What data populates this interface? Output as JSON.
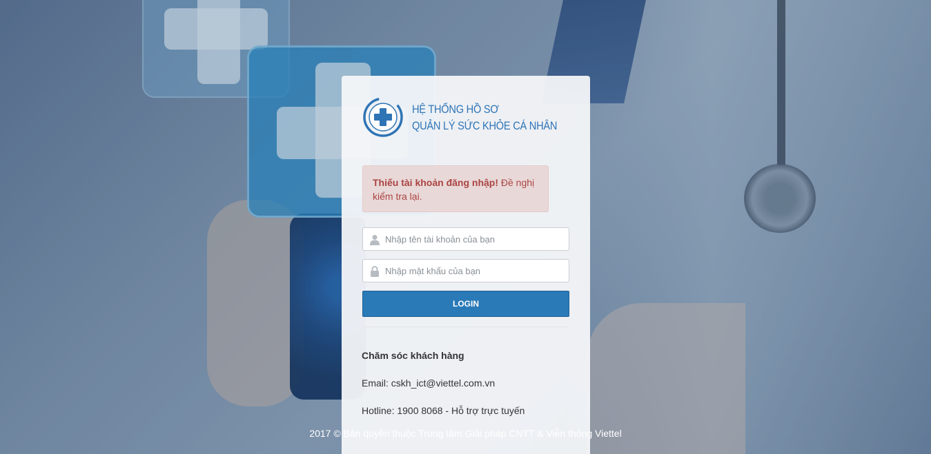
{
  "brand": {
    "line1": "HỆ THỐNG HỒ SƠ",
    "line2": "QUẢN LÝ SỨC KHỎE CÁ NHÂN",
    "color": "#2f74b5"
  },
  "alert": {
    "strong": "Thiếu tài khoản đăng nhập!",
    "message": " Đề nghị kiểm tra lại."
  },
  "form": {
    "username_placeholder": "Nhập tên tài khoản của bạn",
    "password_placeholder": "Nhập mật khẩu của bạn",
    "login_label": "LOGIN"
  },
  "support": {
    "title": "Chăm sóc khách hàng",
    "email": "Email: cskh_ict@viettel.com.vn",
    "hotline": "Hotline: 1900 8068 - Hỗ trợ trực tuyến"
  },
  "footer": {
    "text": "2017 © Bản quyền thuộc Trung tâm Giải pháp CNTT & Viễn thông Viettel"
  },
  "icons": {
    "logo": "medical-cross-icon",
    "user": "user-icon",
    "lock": "lock-icon"
  },
  "colors": {
    "accent": "#2a7ab8",
    "alert_bg": "#e9d8d8",
    "alert_text": "#a94442"
  }
}
